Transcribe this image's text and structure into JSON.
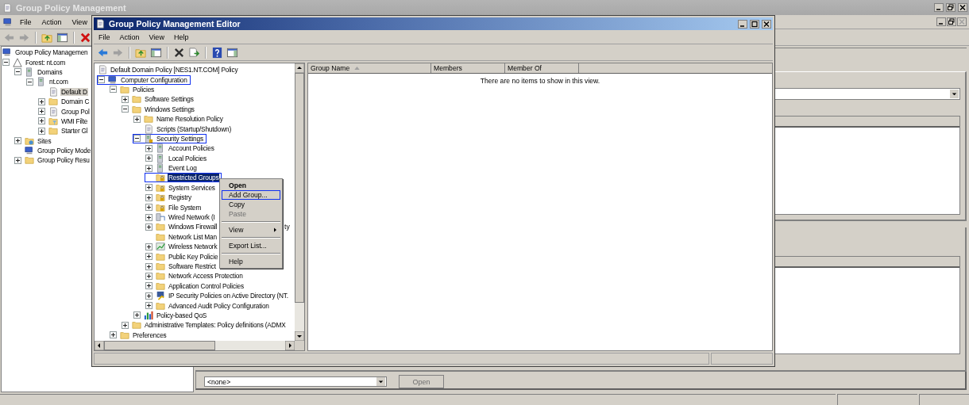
{
  "background_window": {
    "title": "Group Policy Management",
    "menu": [
      "File",
      "Action",
      "View"
    ],
    "tree": [
      {
        "label": "Group Policy Managemen",
        "kind": "console",
        "selected": false,
        "children": [
          {
            "label": "Forest: nt.com",
            "kind": "forest",
            "expanded": true,
            "selected": false,
            "children": [
              {
                "label": "Domains",
                "kind": "domains",
                "expanded": true,
                "selected": false,
                "children": [
                  {
                    "label": "nt.com",
                    "kind": "domain",
                    "expanded": true,
                    "selected": false,
                    "children": [
                      {
                        "label": "Default D",
                        "kind": "policy",
                        "selected": true
                      },
                      {
                        "label": "Domain C",
                        "kind": "folder",
                        "expanded": false,
                        "selected": false
                      },
                      {
                        "label": "Group Pol",
                        "kind": "policy",
                        "expanded": false,
                        "selected": false
                      },
                      {
                        "label": "WMI Filte",
                        "kind": "filter",
                        "expanded": false,
                        "selected": false
                      },
                      {
                        "label": "Starter Gl",
                        "kind": "folder",
                        "expanded": false,
                        "selected": false
                      }
                    ]
                  }
                ]
              },
              {
                "label": "Sites",
                "kind": "sites",
                "expanded": false,
                "selected": false
              },
              {
                "label": "Group Policy Mode",
                "kind": "modeling",
                "selected": false
              },
              {
                "label": "Group Policy Resu",
                "kind": "folder",
                "expanded": false,
                "selected": false
              }
            ]
          }
        ]
      }
    ],
    "bottom_combo": {
      "value": "<none>"
    },
    "open_button": {
      "label": "Open",
      "disabled": true
    }
  },
  "editor": {
    "title": "Group Policy Management Editor",
    "menu": [
      "File",
      "Action",
      "View",
      "Help"
    ],
    "tree": [
      {
        "label": "Default Domain Policy [NES1.NT.COM] Policy",
        "kind": "policy",
        "selected": false,
        "annotated": false,
        "children": [
          {
            "label": "Computer Configuration",
            "kind": "computer",
            "expanded": true,
            "selected": false,
            "annotated": true,
            "children": [
              {
                "label": "Policies",
                "kind": "folder",
                "expanded": true,
                "selected": false,
                "annotated": false,
                "children": [
                  {
                    "label": "Software Settings",
                    "kind": "folder",
                    "expanded": false,
                    "selected": false,
                    "annotated": false
                  },
                  {
                    "label": "Windows Settings",
                    "kind": "folder",
                    "expanded": true,
                    "selected": false,
                    "annotated": false,
                    "children": [
                      {
                        "label": "Name Resolution Policy",
                        "kind": "folder",
                        "expanded": false,
                        "selected": false,
                        "annotated": false
                      },
                      {
                        "label": "Scripts (Startup/Shutdown)",
                        "kind": "script",
                        "selected": false,
                        "annotated": false
                      },
                      {
                        "label": "Security Settings",
                        "kind": "security",
                        "expanded": true,
                        "selected": false,
                        "annotated": true,
                        "children": [
                          {
                            "label": "Account Policies",
                            "kind": "servers",
                            "expanded": false,
                            "selected": false,
                            "annotated": false
                          },
                          {
                            "label": "Local Policies",
                            "kind": "servers",
                            "expanded": false,
                            "selected": false,
                            "annotated": false
                          },
                          {
                            "label": "Event Log",
                            "kind": "servers",
                            "expanded": false,
                            "selected": false,
                            "annotated": false
                          },
                          {
                            "label": "Restricted Groups",
                            "kind": "lockfolder",
                            "selected": true,
                            "annotated": true
                          },
                          {
                            "label": "System Services",
                            "kind": "lockfolder",
                            "expanded": false,
                            "selected": false,
                            "annotated": false
                          },
                          {
                            "label": "Registry",
                            "kind": "lockfolder",
                            "expanded": false,
                            "selected": false,
                            "annotated": false
                          },
                          {
                            "label": "File System",
                            "kind": "lockfolder",
                            "expanded": false,
                            "selected": false,
                            "annotated": false
                          },
                          {
                            "label": "Wired Network (I",
                            "kind": "network",
                            "expanded": false,
                            "selected": false,
                            "annotated": false
                          },
                          {
                            "label": "Windows Firewall",
                            "kind": "folder",
                            "expanded": false,
                            "selected": false,
                            "annotated": false,
                            "tail": "ty"
                          },
                          {
                            "label": "Network List Man",
                            "kind": "folder",
                            "selected": false,
                            "annotated": false
                          },
                          {
                            "label": "Wireless Network",
                            "kind": "wireless",
                            "expanded": false,
                            "selected": false,
                            "annotated": false
                          },
                          {
                            "label": "Public Key Policie",
                            "kind": "folder",
                            "expanded": false,
                            "selected": false,
                            "annotated": false
                          },
                          {
                            "label": "Software Restrict",
                            "kind": "folder",
                            "expanded": false,
                            "selected": false,
                            "annotated": false
                          },
                          {
                            "label": "Network Access Protection",
                            "kind": "folder",
                            "expanded": false,
                            "selected": false,
                            "annotated": false
                          },
                          {
                            "label": "Application Control Policies",
                            "kind": "folder",
                            "expanded": false,
                            "selected": false,
                            "annotated": false
                          },
                          {
                            "label": "IP Security Policies on Active Directory (NT.",
                            "kind": "ipsec",
                            "expanded": false,
                            "selected": false,
                            "annotated": false
                          },
                          {
                            "label": "Advanced Audit Policy Configuration",
                            "kind": "folder",
                            "expanded": false,
                            "selected": false,
                            "annotated": false
                          }
                        ]
                      },
                      {
                        "label": "Policy-based QoS",
                        "kind": "chart",
                        "expanded": false,
                        "selected": false,
                        "annotated": false
                      }
                    ]
                  },
                  {
                    "label": "Administrative Templates: Policy definitions (ADMX",
                    "kind": "folder",
                    "expanded": false,
                    "selected": false,
                    "annotated": false
                  }
                ]
              },
              {
                "label": "Preferences",
                "kind": "folder",
                "expanded": false,
                "selected": false,
                "annotated": false
              }
            ]
          }
        ]
      }
    ],
    "columns": [
      {
        "label": "Group Name",
        "sorted": true
      },
      {
        "label": "Members",
        "sorted": false
      },
      {
        "label": "Member Of",
        "sorted": false
      }
    ],
    "empty_message": "There are no items to show in this view.",
    "context_menu": [
      {
        "kind": "item",
        "label": "Open",
        "bold": true,
        "disabled": false,
        "annotated": false
      },
      {
        "kind": "item",
        "label": "Add Group...",
        "bold": false,
        "disabled": false,
        "annotated": true
      },
      {
        "kind": "item",
        "label": "Copy",
        "bold": false,
        "disabled": false,
        "annotated": false
      },
      {
        "kind": "item",
        "label": "Paste",
        "bold": false,
        "disabled": true,
        "annotated": false
      },
      {
        "kind": "separator"
      },
      {
        "kind": "submenu",
        "label": "View",
        "bold": false,
        "disabled": false,
        "annotated": false
      },
      {
        "kind": "separator"
      },
      {
        "kind": "item",
        "label": "Export List...",
        "bold": false,
        "disabled": false,
        "annotated": false
      },
      {
        "kind": "separator"
      },
      {
        "kind": "item",
        "label": "Help",
        "bold": false,
        "disabled": false,
        "annotated": false
      }
    ]
  }
}
